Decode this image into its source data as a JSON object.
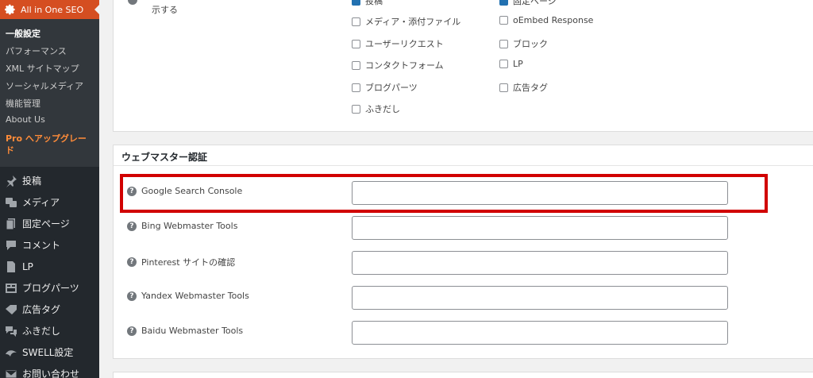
{
  "sidebar": {
    "plugin_title": "All in One SEO",
    "submenu": [
      {
        "label": "一般設定",
        "current": true
      },
      {
        "label": "パフォーマンス"
      },
      {
        "label": "XML サイトマップ"
      },
      {
        "label": "ソーシャルメディア"
      },
      {
        "label": "機能管理"
      },
      {
        "label": "About Us"
      }
    ],
    "pro_prefix": "Pro",
    "pro_label": " へアップグレード",
    "menu": [
      {
        "label": "投稿",
        "icon": "pin-icon"
      },
      {
        "label": "メディア",
        "icon": "media-icon"
      },
      {
        "label": "固定ページ",
        "icon": "page-icon"
      },
      {
        "label": "コメント",
        "icon": "comment-icon"
      },
      {
        "label": "LP",
        "icon": "lp-icon"
      },
      {
        "label": "ブログパーツ",
        "icon": "blog-parts-icon"
      },
      {
        "label": "広告タグ",
        "icon": "ad-tag-icon"
      },
      {
        "label": "ふきだし",
        "icon": "speech-bubble-icon"
      },
      {
        "label": "SWELL設定",
        "icon": "swell-icon"
      },
      {
        "label": "お問い合わせ",
        "icon": "mail-icon"
      }
    ]
  },
  "top_panel": {
    "partial_label_line2": "示する",
    "checkboxes_col1": [
      {
        "label": "投稿",
        "checked": true
      },
      {
        "label": "メディア・添付ファイル",
        "checked": false
      },
      {
        "label": "ユーザーリクエスト",
        "checked": false
      },
      {
        "label": "コンタクトフォーム",
        "checked": false
      },
      {
        "label": "ブログパーツ",
        "checked": false
      },
      {
        "label": "ふきだし",
        "checked": false
      }
    ],
    "checkboxes_col2": [
      {
        "label": "固定ページ",
        "checked": true
      },
      {
        "label": "oEmbed Response",
        "checked": false
      },
      {
        "label": "ブロック",
        "checked": false
      },
      {
        "label": "LP",
        "checked": false
      },
      {
        "label": "広告タグ",
        "checked": false
      }
    ]
  },
  "webmaster": {
    "title": "ウェブマスター認証",
    "rows": [
      {
        "label": "Google Search Console",
        "value": ""
      },
      {
        "label": "Bing Webmaster Tools",
        "value": ""
      },
      {
        "label": "Pinterest サイトの確認",
        "value": ""
      },
      {
        "label": "Yandex Webmaster Tools",
        "value": ""
      },
      {
        "label": "Baidu Webmaster Tools",
        "value": ""
      }
    ],
    "help_glyph": "?"
  },
  "colors": {
    "sidebar_bg": "#23282d",
    "plugin_accent": "#d54e21",
    "pro_accent": "#ff8c39",
    "highlight": "#d10000",
    "checkbox_checked": "#2271b1"
  }
}
